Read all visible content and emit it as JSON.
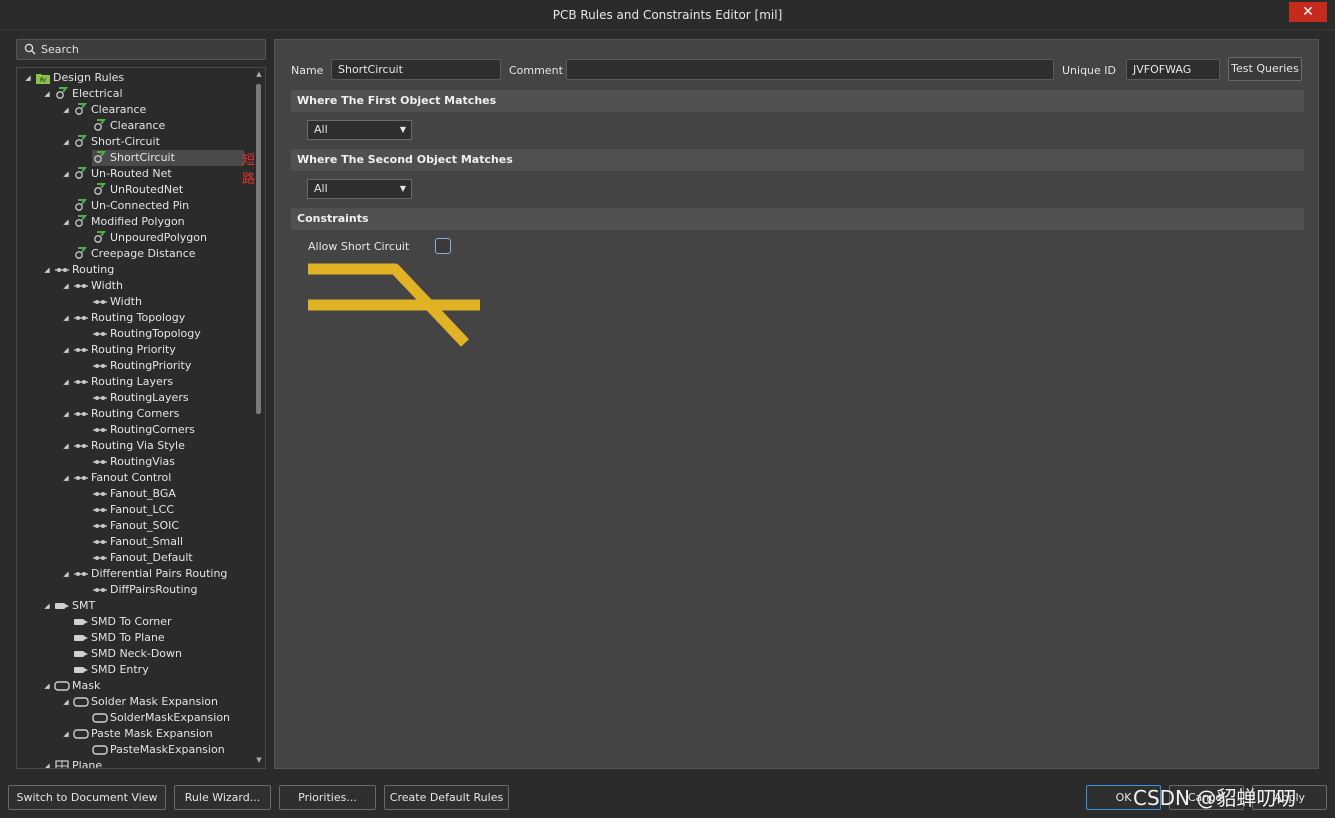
{
  "window": {
    "title": "PCB Rules and Constraints Editor [mil]",
    "close_glyph": "✕"
  },
  "search": {
    "placeholder": "Search"
  },
  "tree": [
    {
      "label": "Design Rules",
      "level": 0,
      "arrow": true,
      "icon": "folder"
    },
    {
      "label": "Electrical",
      "level": 1,
      "arrow": true,
      "icon": "rule-green"
    },
    {
      "label": "Clearance",
      "level": 2,
      "arrow": true,
      "icon": "rule-green"
    },
    {
      "label": "Clearance",
      "level": 3,
      "arrow": false,
      "icon": "rule-green"
    },
    {
      "label": "Short-Circuit",
      "level": 2,
      "arrow": true,
      "icon": "rule-green"
    },
    {
      "label": "ShortCircuit",
      "level": 3,
      "arrow": false,
      "icon": "rule-green",
      "selected": true
    },
    {
      "label": "Un-Routed Net",
      "level": 2,
      "arrow": true,
      "icon": "rule-green"
    },
    {
      "label": "UnRoutedNet",
      "level": 3,
      "arrow": false,
      "icon": "rule-green"
    },
    {
      "label": "Un-Connected Pin",
      "level": 2,
      "arrow": false,
      "icon": "rule-green"
    },
    {
      "label": "Modified Polygon",
      "level": 2,
      "arrow": true,
      "icon": "rule-green"
    },
    {
      "label": "UnpouredPolygon",
      "level": 3,
      "arrow": false,
      "icon": "rule-green"
    },
    {
      "label": "Creepage Distance",
      "level": 2,
      "arrow": false,
      "icon": "rule-green"
    },
    {
      "label": "Routing",
      "level": 1,
      "arrow": true,
      "icon": "routing"
    },
    {
      "label": "Width",
      "level": 2,
      "arrow": true,
      "icon": "routing"
    },
    {
      "label": "Width",
      "level": 3,
      "arrow": false,
      "icon": "routing"
    },
    {
      "label": "Routing Topology",
      "level": 2,
      "arrow": true,
      "icon": "routing"
    },
    {
      "label": "RoutingTopology",
      "level": 3,
      "arrow": false,
      "icon": "routing"
    },
    {
      "label": "Routing Priority",
      "level": 2,
      "arrow": true,
      "icon": "routing"
    },
    {
      "label": "RoutingPriority",
      "level": 3,
      "arrow": false,
      "icon": "routing"
    },
    {
      "label": "Routing Layers",
      "level": 2,
      "arrow": true,
      "icon": "routing"
    },
    {
      "label": "RoutingLayers",
      "level": 3,
      "arrow": false,
      "icon": "routing"
    },
    {
      "label": "Routing Corners",
      "level": 2,
      "arrow": true,
      "icon": "routing"
    },
    {
      "label": "RoutingCorners",
      "level": 3,
      "arrow": false,
      "icon": "routing"
    },
    {
      "label": "Routing Via Style",
      "level": 2,
      "arrow": true,
      "icon": "routing"
    },
    {
      "label": "RoutingVias",
      "level": 3,
      "arrow": false,
      "icon": "routing"
    },
    {
      "label": "Fanout Control",
      "level": 2,
      "arrow": true,
      "icon": "routing"
    },
    {
      "label": "Fanout_BGA",
      "level": 3,
      "arrow": false,
      "icon": "routing"
    },
    {
      "label": "Fanout_LCC",
      "level": 3,
      "arrow": false,
      "icon": "routing"
    },
    {
      "label": "Fanout_SOIC",
      "level": 3,
      "arrow": false,
      "icon": "routing"
    },
    {
      "label": "Fanout_Small",
      "level": 3,
      "arrow": false,
      "icon": "routing"
    },
    {
      "label": "Fanout_Default",
      "level": 3,
      "arrow": false,
      "icon": "routing"
    },
    {
      "label": "Differential Pairs Routing",
      "level": 2,
      "arrow": true,
      "icon": "routing"
    },
    {
      "label": "DiffPairsRouting",
      "level": 3,
      "arrow": false,
      "icon": "routing"
    },
    {
      "label": "SMT",
      "level": 1,
      "arrow": true,
      "icon": "smt"
    },
    {
      "label": "SMD To Corner",
      "level": 2,
      "arrow": false,
      "icon": "smt"
    },
    {
      "label": "SMD To Plane",
      "level": 2,
      "arrow": false,
      "icon": "smt"
    },
    {
      "label": "SMD Neck-Down",
      "level": 2,
      "arrow": false,
      "icon": "smt"
    },
    {
      "label": "SMD Entry",
      "level": 2,
      "arrow": false,
      "icon": "smt"
    },
    {
      "label": "Mask",
      "level": 1,
      "arrow": true,
      "icon": "mask"
    },
    {
      "label": "Solder Mask Expansion",
      "level": 2,
      "arrow": true,
      "icon": "mask"
    },
    {
      "label": "SolderMaskExpansion",
      "level": 3,
      "arrow": false,
      "icon": "mask"
    },
    {
      "label": "Paste Mask Expansion",
      "level": 2,
      "arrow": true,
      "icon": "mask"
    },
    {
      "label": "PasteMaskExpansion",
      "level": 3,
      "arrow": false,
      "icon": "mask"
    },
    {
      "label": "Plane",
      "level": 1,
      "arrow": true,
      "icon": "plane"
    }
  ],
  "annotation": "短路",
  "rule": {
    "name_label": "Name",
    "name_value": "ShortCircuit",
    "comment_label": "Comment",
    "comment_value": "",
    "uid_label": "Unique ID",
    "uid_value": "JVFOFWAG",
    "test_queries": "Test Queries"
  },
  "sections": {
    "first": "Where The First Object Matches",
    "first_value": "All",
    "second": "Where The Second Object Matches",
    "second_value": "All",
    "constraints": "Constraints",
    "allow_short": "Allow Short Circuit",
    "allow_short_checked": false
  },
  "colors": {
    "track": "#e1b224",
    "selection": "#4a4a4a",
    "accent": "#3d8ee0"
  },
  "buttons": {
    "switch_view": "Switch to Document View",
    "rule_wizard": "Rule Wizard...",
    "priorities": "Priorities...",
    "create_default": "Create Default Rules",
    "ok": "OK",
    "cancel": "Cancel",
    "apply": "Apply"
  },
  "watermark": "CSDN @貂蝉叨叨"
}
